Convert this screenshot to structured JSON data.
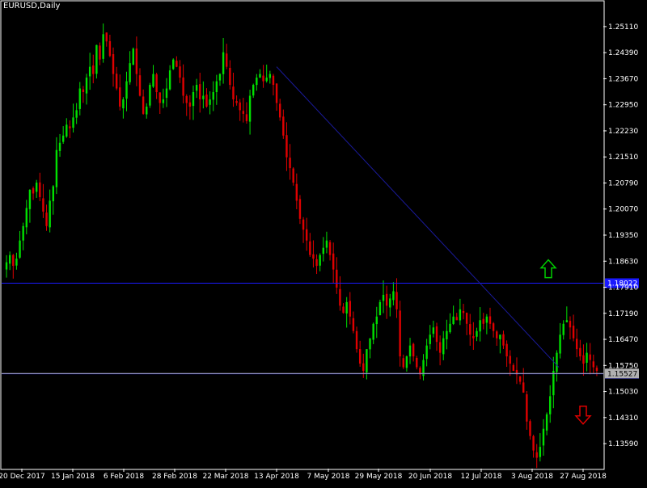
{
  "window": {
    "symbol_timeframe": "EURUSD,Daily"
  },
  "colors": {
    "background": "#000000",
    "frame": "#ffffff",
    "bull": "#00e000",
    "bear": "#e00000",
    "trendline": "#1a1a9a",
    "level_line": "#1a1aff",
    "price_line": "#b0b0b0",
    "up_arrow": "#00cc00",
    "down_arrow": "#dd0000"
  },
  "chart_data": {
    "type": "candlestick",
    "title": "EURUSD,Daily",
    "ylim": [
      1.129,
      1.258
    ],
    "y_ticks": [
      "1.25110",
      "1.24390",
      "1.23670",
      "1.22950",
      "1.22230",
      "1.21510",
      "1.20790",
      "1.20070",
      "1.19350",
      "1.18630",
      "1.17910",
      "1.17190",
      "1.16470",
      "1.15750",
      "1.15030",
      "1.14310",
      "1.13590"
    ],
    "x_ticks": [
      "20 Dec 2017",
      "15 Jan 2018",
      "6 Feb 2018",
      "28 Feb 2018",
      "22 Mar 2018",
      "13 Apr 2018",
      "7 May 2018",
      "29 May 2018",
      "20 Jun 2018",
      "12 Jul 2018",
      "3 Aug 2018",
      "27 Aug 2018"
    ],
    "close_series": [
      1.186,
      1.188,
      1.185,
      1.187,
      1.192,
      1.196,
      1.201,
      1.206,
      1.205,
      1.208,
      1.204,
      1.2,
      1.196,
      1.203,
      1.207,
      1.217,
      1.219,
      1.221,
      1.224,
      1.223,
      1.226,
      1.228,
      1.234,
      1.233,
      1.237,
      1.24,
      1.238,
      1.246,
      1.242,
      1.249,
      1.247,
      1.243,
      1.238,
      1.234,
      1.229,
      1.231,
      1.236,
      1.241,
      1.245,
      1.238,
      1.232,
      1.227,
      1.229,
      1.235,
      1.238,
      1.233,
      1.23,
      1.231,
      1.234,
      1.239,
      1.242,
      1.24,
      1.237,
      1.232,
      1.23,
      1.229,
      1.233,
      1.235,
      1.231,
      1.232,
      1.229,
      1.231,
      1.233,
      1.236,
      1.238,
      1.244,
      1.24,
      1.235,
      1.231,
      1.23,
      1.228,
      1.227,
      1.225,
      1.232,
      1.235,
      1.237,
      1.238,
      1.236,
      1.237,
      1.238,
      1.235,
      1.23,
      1.226,
      1.221,
      1.215,
      1.212,
      1.208,
      1.203,
      1.198,
      1.195,
      1.192,
      1.188,
      1.187,
      1.185,
      1.188,
      1.19,
      1.192,
      1.188,
      1.184,
      1.179,
      1.174,
      1.172,
      1.175,
      1.171,
      1.167,
      1.162,
      1.158,
      1.156,
      1.162,
      1.165,
      1.169,
      1.171,
      1.175,
      1.177,
      1.174,
      1.176,
      1.178,
      1.173,
      1.16,
      1.157,
      1.16,
      1.163,
      1.16,
      1.157,
      1.155,
      1.159,
      1.163,
      1.166,
      1.168,
      1.164,
      1.161,
      1.165,
      1.167,
      1.169,
      1.171,
      1.17,
      1.173,
      1.172,
      1.169,
      1.166,
      1.165,
      1.167,
      1.17,
      1.169,
      1.171,
      1.169,
      1.167,
      1.165,
      1.166,
      1.163,
      1.16,
      1.158,
      1.156,
      1.155,
      1.153,
      1.15,
      1.142,
      1.138,
      1.134,
      1.132,
      1.135,
      1.14,
      1.144,
      1.149,
      1.156,
      1.161,
      1.166,
      1.169,
      1.17,
      1.168,
      1.165,
      1.162,
      1.16,
      1.158,
      1.161,
      1.159,
      1.157,
      1.156
    ],
    "horizontal_levels": [
      {
        "label": "1.18022",
        "value": 1.18022
      },
      {
        "label": "1.15521",
        "value": 1.15521
      }
    ],
    "current_price": {
      "label": "1.15527",
      "value": 1.15527
    },
    "trendline": {
      "from": {
        "x": "13 Apr 2018",
        "y": 1.24
      },
      "to": {
        "x": "27 Aug 2018",
        "y": 1.157
      }
    },
    "signals": [
      {
        "type": "up-arrow",
        "x": "3 Aug 2018",
        "y": 1.184
      },
      {
        "type": "down-arrow",
        "x": "27 Aug 2018",
        "y": 1.144
      }
    ]
  }
}
